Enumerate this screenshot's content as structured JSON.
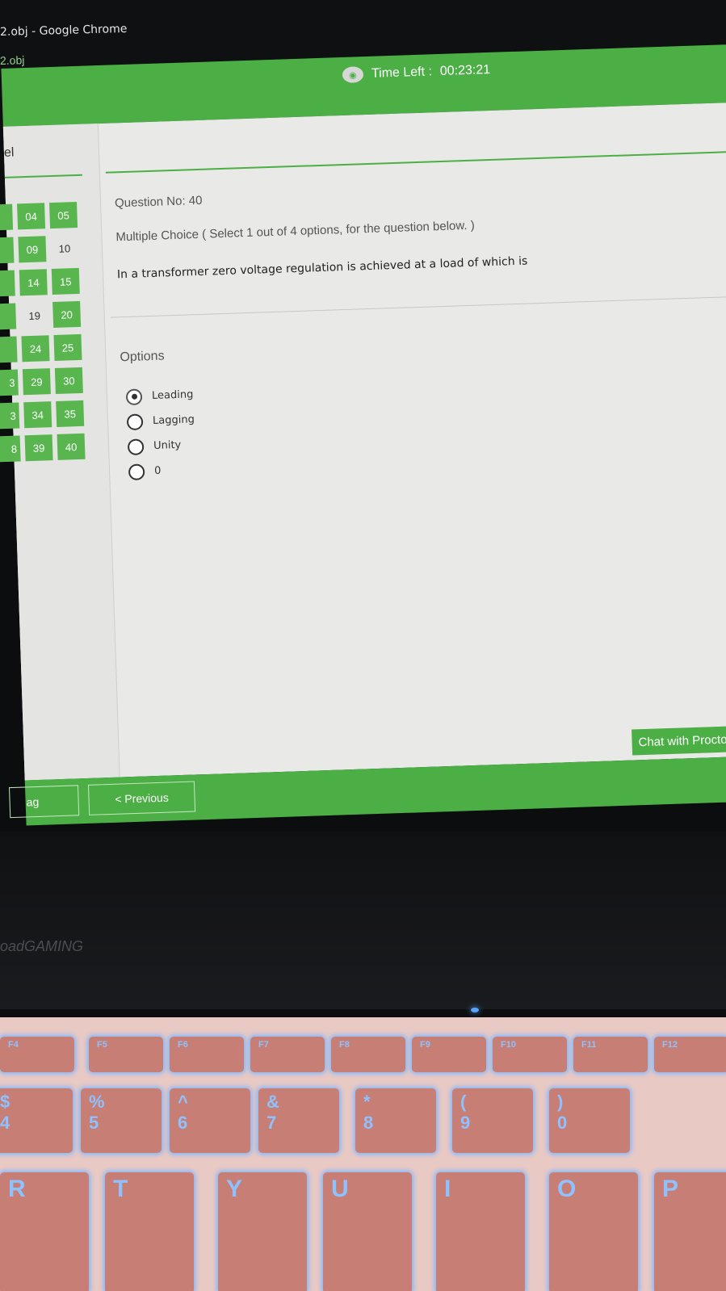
{
  "window": {
    "title": "2.obj - Google Chrome",
    "tab": "2.obj"
  },
  "header": {
    "timer_label": "Time Left :",
    "timer_value": "00:23:21"
  },
  "sidebar": {
    "label": "el",
    "questions": [
      {
        "num": "04",
        "answered": true
      },
      {
        "num": "05",
        "answered": true
      },
      {
        "num": "09",
        "answered": true
      },
      {
        "num": "10",
        "answered": false
      },
      {
        "num": "14",
        "answered": true
      },
      {
        "num": "15",
        "answered": true
      },
      {
        "num": "19",
        "answered": false
      },
      {
        "num": "20",
        "answered": true
      },
      {
        "num": "24",
        "answered": true
      },
      {
        "num": "25",
        "answered": true
      },
      {
        "num": "29",
        "answered": true
      },
      {
        "num": "30",
        "answered": true
      },
      {
        "num": "34",
        "answered": true
      },
      {
        "num": "35",
        "answered": true
      },
      {
        "num": "39",
        "answered": true
      },
      {
        "num": "40",
        "answered": true
      }
    ],
    "partial_left": [
      "3",
      "3",
      "8"
    ]
  },
  "question": {
    "number_label": "Question No: 40",
    "type_label": "Multiple Choice ( Select 1 out of 4 options, for the question below. )",
    "text": "In a transformer zero voltage regulation is achieved at a load of which is"
  },
  "options": {
    "title": "Options",
    "items": [
      {
        "label": "Leading",
        "selected": true
      },
      {
        "label": "Lagging",
        "selected": false
      },
      {
        "label": "Unity",
        "selected": false
      },
      {
        "label": "0",
        "selected": false
      }
    ]
  },
  "chat": {
    "label": "Chat with Proctor - VIHAN SINGH"
  },
  "footer": {
    "flag_label": "ag",
    "previous_label": "< Previous"
  },
  "laptop": {
    "brand": "oad",
    "brand_suffix": "GAMING"
  },
  "keyboard": {
    "fn_keys": [
      "F4",
      "F5",
      "F6",
      "F7",
      "F8",
      "F9",
      "F10",
      "F11",
      "F12"
    ],
    "number_keys": [
      "$",
      "%",
      "^",
      "&",
      "*",
      "(",
      ")",
      "4",
      "5",
      "6",
      "7",
      "8",
      "9",
      "0"
    ],
    "letter_keys": [
      "R",
      "T",
      "Y",
      "U",
      "I",
      "O",
      "P"
    ]
  },
  "colors": {
    "accent_green": "#4caf45",
    "key_glow": "#7fb6ff"
  }
}
